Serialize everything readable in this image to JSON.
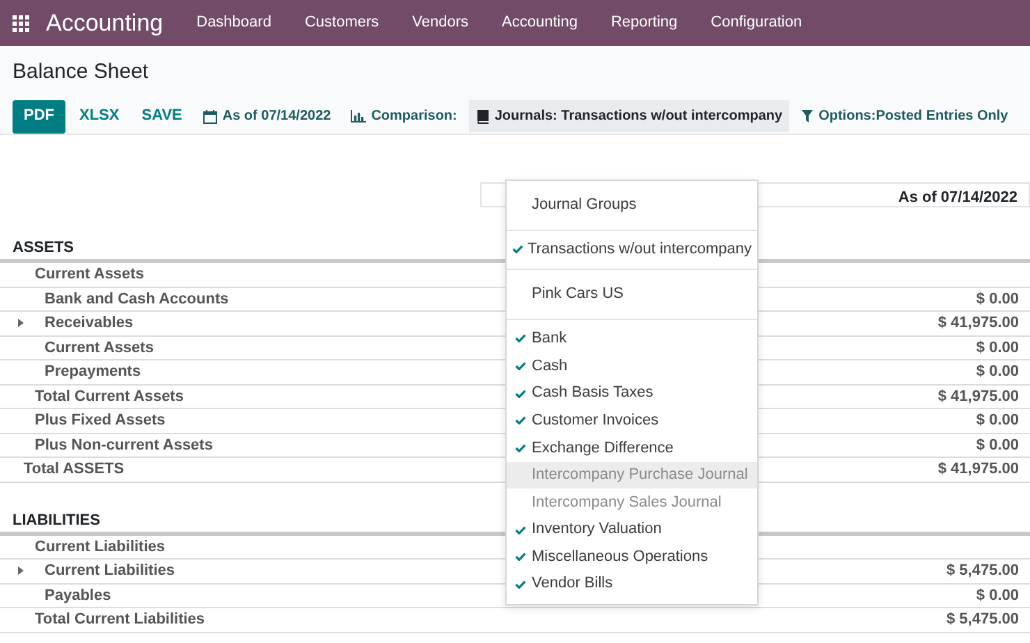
{
  "navbar": {
    "app_title": "Accounting",
    "menu": [
      "Dashboard",
      "Customers",
      "Vendors",
      "Accounting",
      "Reporting",
      "Configuration"
    ]
  },
  "page_title": "Balance Sheet",
  "toolbar": {
    "buttons": [
      {
        "label": "PDF",
        "kind": "primary"
      },
      {
        "label": "XLSX",
        "kind": "link"
      },
      {
        "label": "SAVE",
        "kind": "link"
      }
    ],
    "filters": [
      {
        "label": "As of 07/14/2022",
        "kind": "date",
        "open": false
      },
      {
        "label": "Comparison:",
        "kind": "comparison",
        "open": false
      },
      {
        "label": "Journals: Transactions w/out intercompany",
        "kind": "journals",
        "open": true
      },
      {
        "label": "Options:Posted Entries Only",
        "kind": "options",
        "open": false
      }
    ]
  },
  "journals_menu": [
    {
      "kind": "header",
      "label": "Journal Groups"
    },
    {
      "kind": "divider"
    },
    {
      "kind": "option",
      "label": "Transactions w/out intercompany",
      "checked": true,
      "highlighted": false
    },
    {
      "kind": "divider"
    },
    {
      "kind": "header",
      "label": "Pink Cars US"
    },
    {
      "kind": "divider"
    },
    {
      "kind": "option",
      "label": "Bank",
      "checked": true,
      "highlighted": false
    },
    {
      "kind": "option",
      "label": "Cash",
      "checked": true,
      "highlighted": false
    },
    {
      "kind": "option",
      "label": "Cash Basis Taxes",
      "checked": true,
      "highlighted": false
    },
    {
      "kind": "option",
      "label": "Customer Invoices",
      "checked": true,
      "highlighted": false
    },
    {
      "kind": "option",
      "label": "Exchange Difference",
      "checked": true,
      "highlighted": false
    },
    {
      "kind": "option",
      "label": "Intercompany Purchase Journal",
      "checked": false,
      "highlighted": true
    },
    {
      "kind": "option",
      "label": "Intercompany Sales Journal",
      "checked": false,
      "highlighted": false
    },
    {
      "kind": "option",
      "label": "Inventory Valuation",
      "checked": true,
      "highlighted": false
    },
    {
      "kind": "option",
      "label": "Miscellaneous Operations",
      "checked": true,
      "highlighted": false
    },
    {
      "kind": "option",
      "label": "Vendor Bills",
      "checked": true,
      "highlighted": false
    }
  ],
  "report": {
    "column_header": "As of 07/14/2022",
    "sections": [
      {
        "title": "ASSETS",
        "lines": [
          {
            "label": "Current Assets",
            "children": [
              {
                "label": "Bank and Cash Accounts",
                "amount": "$ 0.00",
                "expandable": false
              },
              {
                "label": "Receivables",
                "amount": "$ 41,975.00",
                "expandable": true
              },
              {
                "label": "Current Assets",
                "amount": "$ 0.00",
                "expandable": false
              },
              {
                "label": "Prepayments",
                "amount": "$ 0.00",
                "expandable": false
              }
            ]
          },
          {
            "label": "Total Current Assets",
            "amount": "$ 41,975.00"
          },
          {
            "label": "Plus Fixed Assets",
            "amount": "$ 0.00"
          },
          {
            "label": "Plus Non-current Assets",
            "amount": "$ 0.00"
          }
        ],
        "total": {
          "label": "Total ASSETS",
          "amount": "$ 41,975.00"
        }
      },
      {
        "title": "LIABILITIES",
        "lines": [
          {
            "label": "Current Liabilities",
            "children": [
              {
                "label": "Current Liabilities",
                "amount": "$ 5,475.00",
                "expandable": true
              },
              {
                "label": "Payables",
                "amount": "$ 0.00",
                "expandable": false
              }
            ]
          },
          {
            "label": "Total Current Liabilities",
            "amount": "$ 5,475.00"
          }
        ]
      }
    ]
  }
}
